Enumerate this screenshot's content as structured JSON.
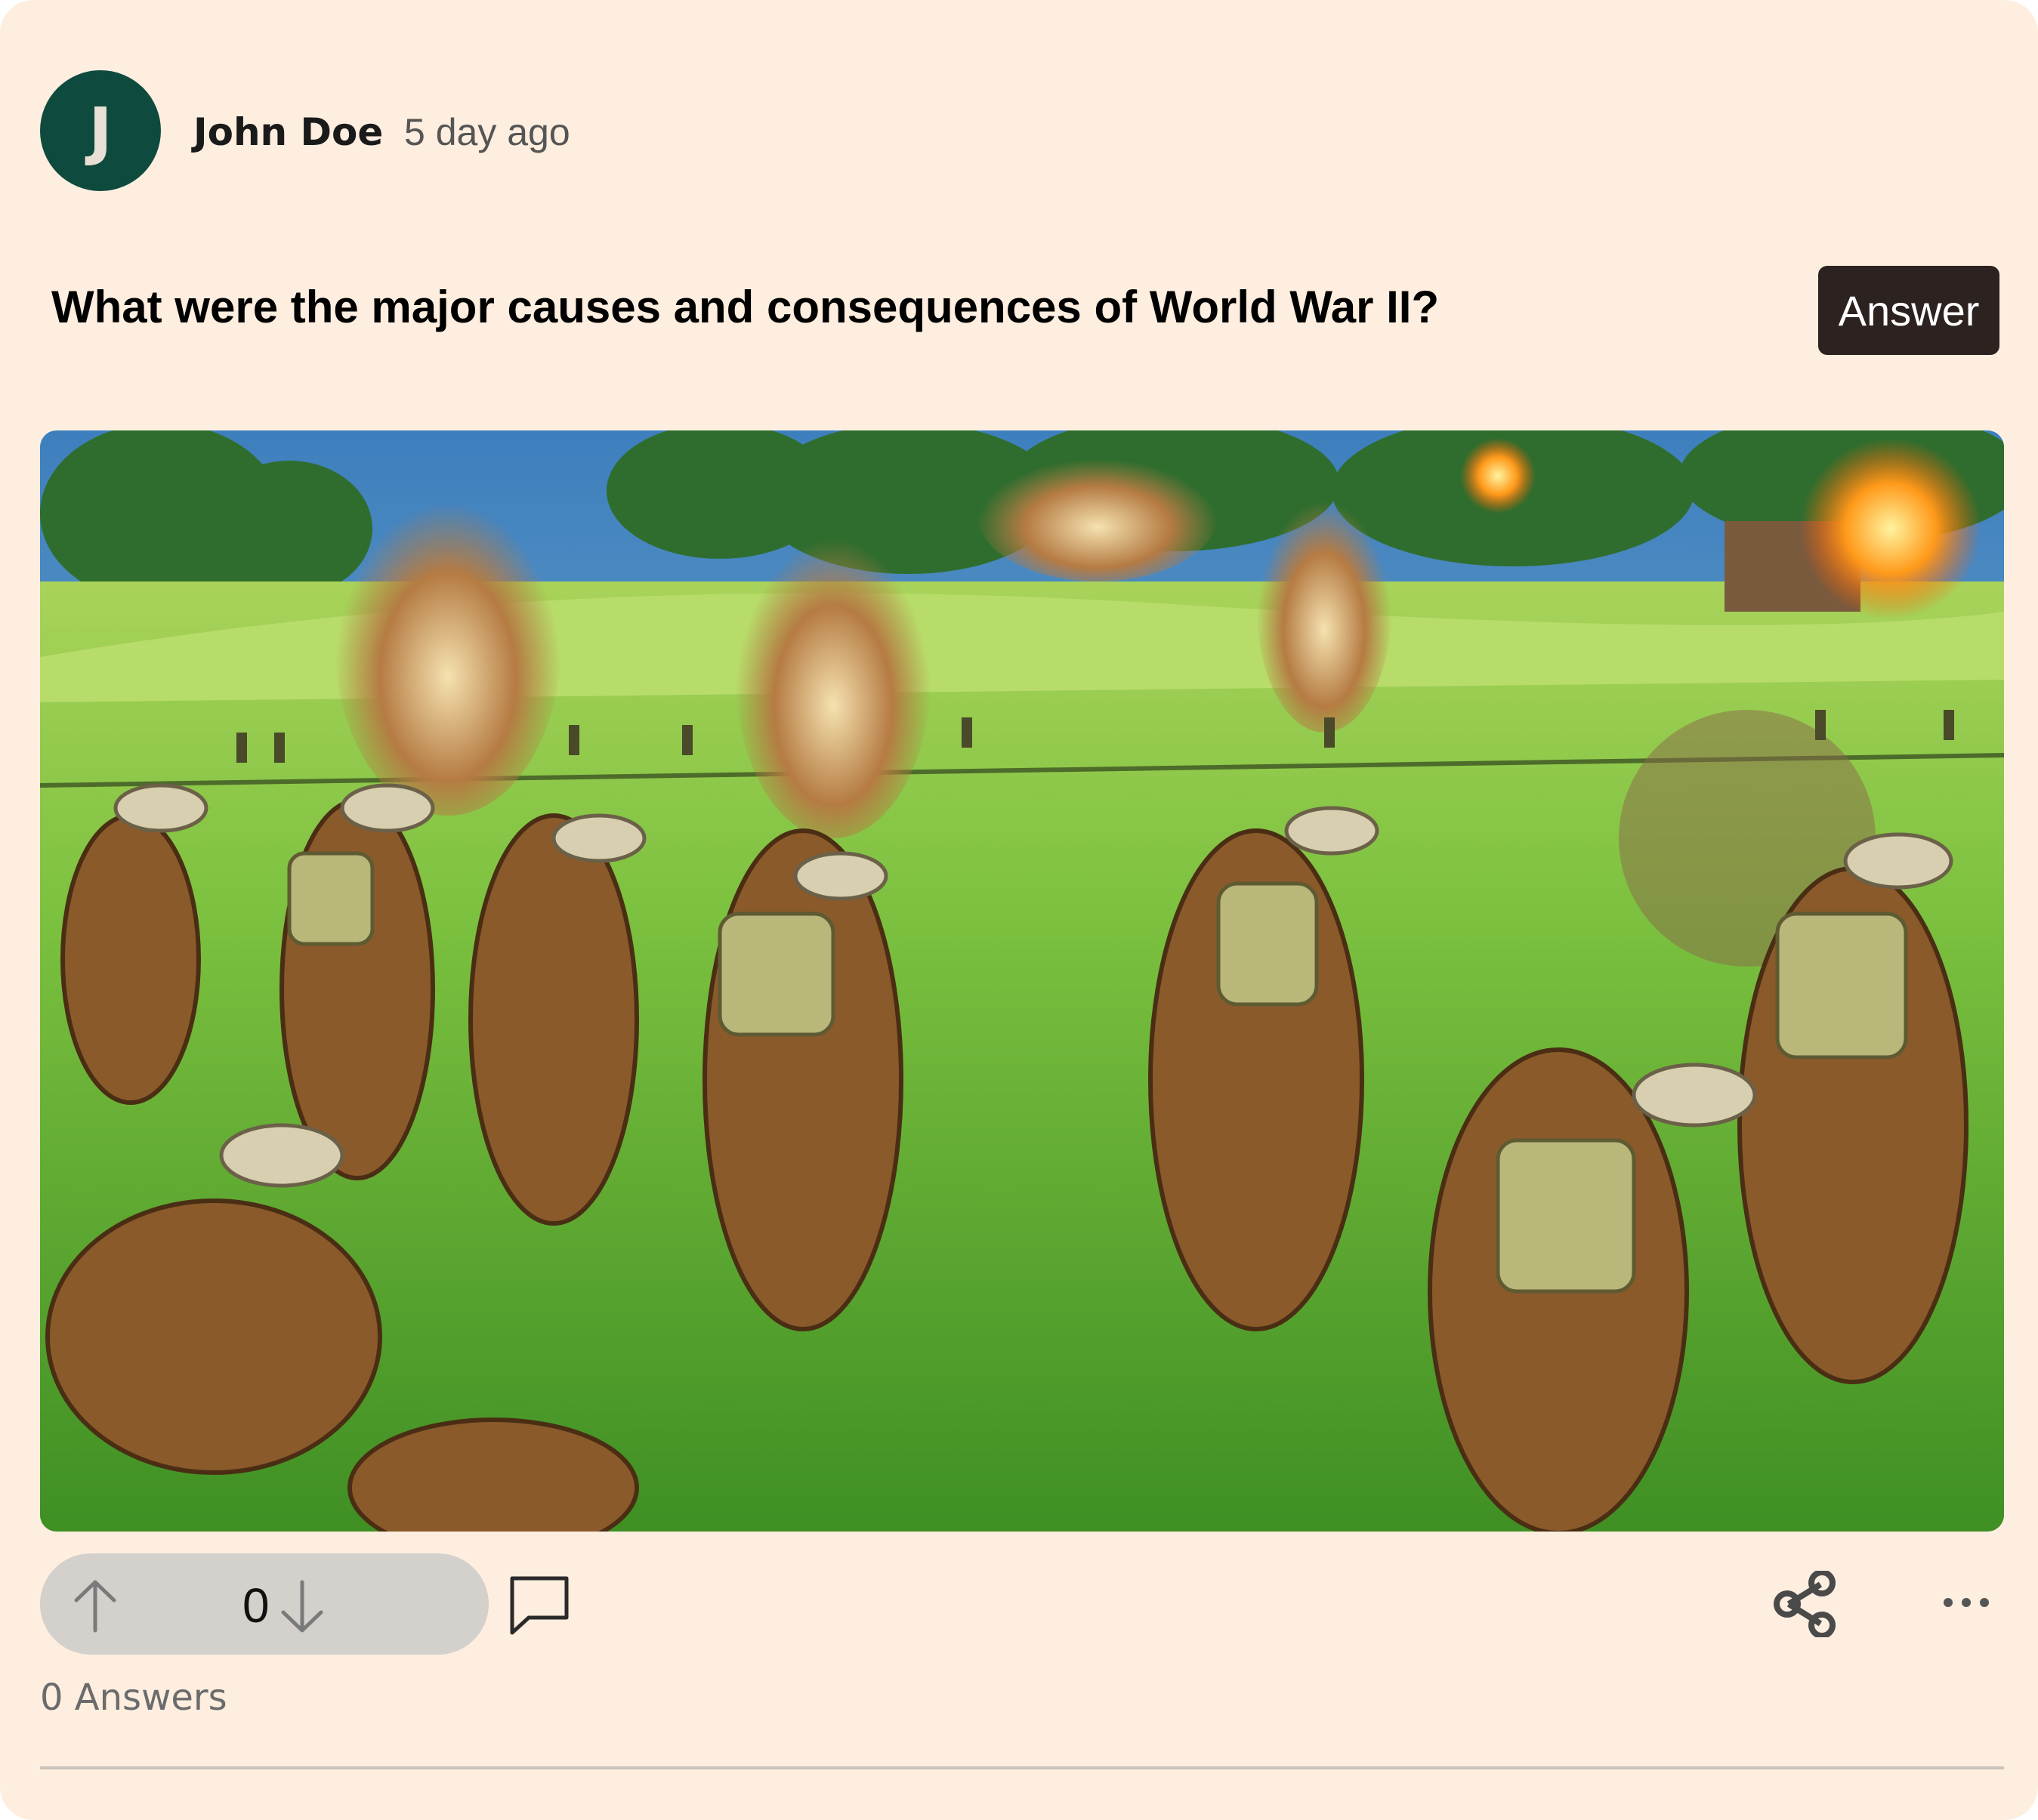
{
  "post": {
    "avatar_initial": "J",
    "author": "John Doe",
    "time": "5 day ago",
    "question": "What were the major causes and consequences of World War II?",
    "answer_label": "Answer",
    "image_alt": "Painting of WWII soldiers advancing across a grassy field amid explosions"
  },
  "actions": {
    "vote_count": "0",
    "answers_count": "0 Answers"
  },
  "colors": {
    "card_bg": "#fdeedf",
    "avatar_bg": "#0f4a3e",
    "answer_button_bg": "#2c221f",
    "vote_pill_bg": "#d4d0cb"
  },
  "icons": [
    "upvote-arrow-icon",
    "downvote-arrow-icon",
    "comment-icon",
    "share-icon",
    "more-options-icon"
  ]
}
